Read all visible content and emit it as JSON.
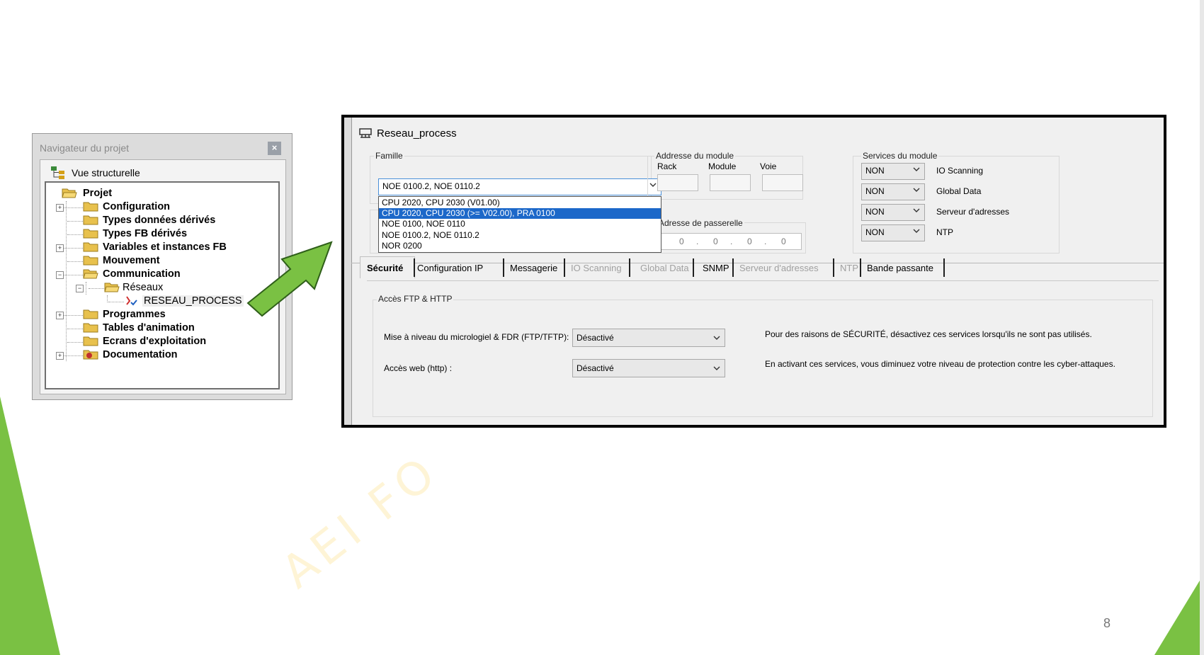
{
  "slide": {
    "page_number": "8",
    "watermark": "AEI FO"
  },
  "navigator": {
    "title": "Navigateur du projet",
    "close": "×",
    "view_label": "Vue structurelle",
    "tree": [
      {
        "label": "Projet",
        "bold": true
      },
      {
        "label": "Configuration",
        "bold": true
      },
      {
        "label": "Types données dérivés",
        "bold": true
      },
      {
        "label": "Types FB dérivés",
        "bold": true
      },
      {
        "label": "Variables et instances FB",
        "bold": true
      },
      {
        "label": "Mouvement",
        "bold": true
      },
      {
        "label": "Communication",
        "bold": true
      },
      {
        "label": "Réseaux",
        "bold": false
      },
      {
        "label": "RESEAU_PROCESS",
        "bold": false
      },
      {
        "label": "Programmes",
        "bold": true
      },
      {
        "label": "Tables d'animation",
        "bold": true
      },
      {
        "label": "Ecrans d'exploitation",
        "bold": true
      },
      {
        "label": "Documentation",
        "bold": true
      }
    ]
  },
  "dialog": {
    "title": "Reseau_process",
    "famille": {
      "label": "Famille",
      "selected": "NOE 0100.2, NOE 0110.2",
      "options": [
        "CPU 2020, CPU 2030 (V01.00)",
        "CPU 2020, CPU 2030 (>= V02.00), PRA 0100",
        "NOE 0100, NOE 0110",
        "NOE 0100.2, NOE 0110.2",
        "NOR 0200"
      ],
      "highlighted": "CPU 2020, CPU 2030 (>= V02.00), PRA 0100"
    },
    "adresse_module": {
      "label": "Addresse du module",
      "rack": "Rack",
      "module": "Module",
      "voie": "Voie"
    },
    "passerelle": {
      "label": "Adresse de passerelle",
      "segments": [
        "0",
        "0",
        "0",
        "0"
      ]
    },
    "services": {
      "label": "Services du module",
      "items": [
        {
          "value": "NON",
          "name": "IO Scanning"
        },
        {
          "value": "NON",
          "name": "Global Data"
        },
        {
          "value": "NON",
          "name": "Serveur d'adresses"
        },
        {
          "value": "NON",
          "name": "NTP"
        }
      ]
    },
    "tabs": [
      {
        "label": "Sécurité",
        "active": true,
        "disabled": false
      },
      {
        "label": "Configuration IP",
        "active": false,
        "disabled": false
      },
      {
        "label": "Messagerie",
        "active": false,
        "disabled": false
      },
      {
        "label": "IO Scanning",
        "active": false,
        "disabled": true
      },
      {
        "label": "Global Data",
        "active": false,
        "disabled": true
      },
      {
        "label": "SNMP",
        "active": false,
        "disabled": false
      },
      {
        "label": "Serveur d'adresses",
        "active": false,
        "disabled": true
      },
      {
        "label": "NTP",
        "active": false,
        "disabled": true
      },
      {
        "label": "Bande passante",
        "active": false,
        "disabled": false
      }
    ],
    "security": {
      "group_label": "Accès FTP & HTTP",
      "ftp_label": "Mise à niveau du micrologiel & FDR (FTP/TFTP):",
      "ftp_value": "Désactivé",
      "web_label": "Accès web (http) :",
      "web_value": "Désactivé",
      "info1": "Pour des raisons de SÉCURITÉ, désactivez ces services lorsqu'ils ne sont pas utilisés.",
      "info2": "En activant ces services, vous diminuez votre niveau de protection contre les cyber-attaques."
    }
  },
  "colors": {
    "accent_green": "#7ac143",
    "selection_blue": "#1c68c9"
  }
}
